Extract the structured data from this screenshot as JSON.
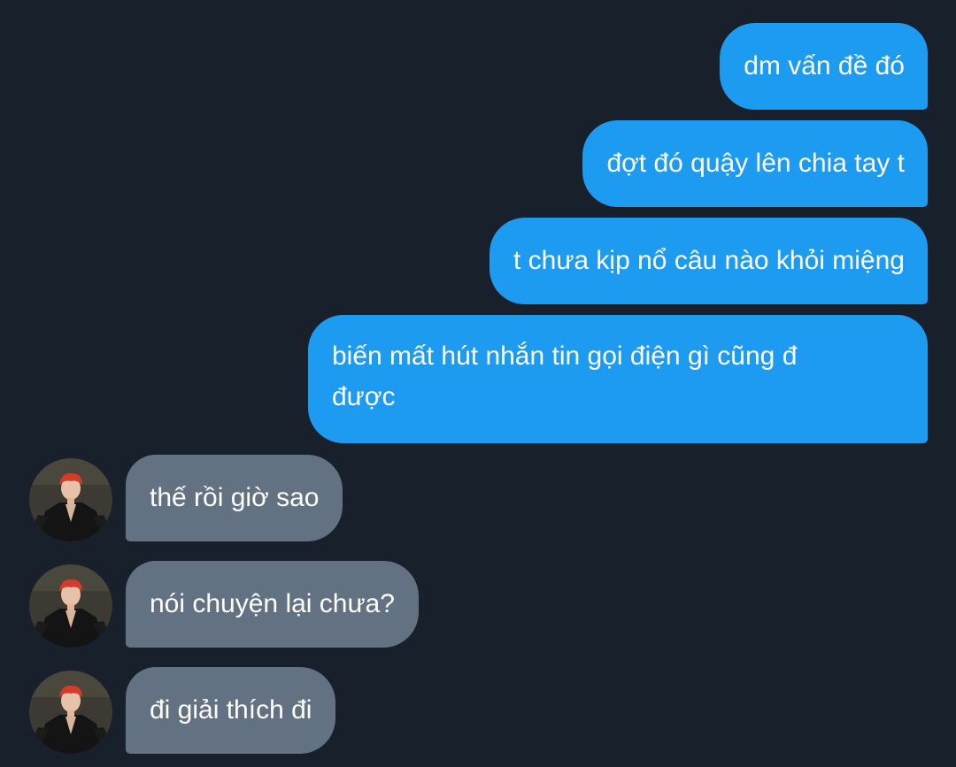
{
  "conversation": {
    "outgoing": [
      {
        "text": "dm vấn đề đó"
      },
      {
        "text": "đợt đó quậy lên chia tay t"
      },
      {
        "text": "t chưa kịp nổ câu nào khỏi miệng"
      },
      {
        "text": "biến mất hút nhắn tin gọi điện gì cũng đ được"
      }
    ],
    "incoming": [
      {
        "text": "thế rồi giờ sao",
        "avatar": "contact-avatar-photo"
      },
      {
        "text": "nói chuyện lại chưa?",
        "avatar": "contact-avatar-photo"
      },
      {
        "text": "đi giải thích đi",
        "avatar": "contact-avatar-photo"
      }
    ]
  },
  "colors": {
    "background": "#17202b",
    "outgoing_bubble": "#1d9bf0",
    "incoming_bubble": "#637282",
    "text": "#ffffff"
  }
}
